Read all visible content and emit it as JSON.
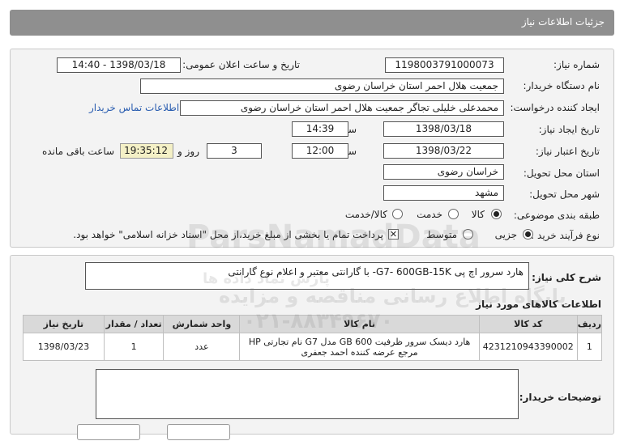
{
  "header": {
    "title": "جزئیات اطلاعات نیاز"
  },
  "form": {
    "need_number_label": "شماره نیاز:",
    "need_number": "1198003791000073",
    "announce_label": "تاریخ و ساعت اعلان عمومی:",
    "announce_value": "1398/03/18 - 14:40",
    "buyer_org_label": "نام دستگاه خریدار:",
    "buyer_org": "جمعیت هلال احمر استان خراسان رضوی",
    "requester_label": "ایجاد کننده درخواست:",
    "requester": "محمدعلی خلیلی تجاگر جمعیت هلال احمر استان خراسان رضوی",
    "contact_link": "اطلاعات تماس خریدار",
    "created_label": "تاریخ ایجاد نیاز:",
    "created_date": "1398/03/18",
    "time_label": "ساعت",
    "created_time": "14:39",
    "validity_label": "تاریخ اعتبار نیاز:",
    "validity_date": "1398/03/22",
    "validity_time": "12:00",
    "days_label": "روز و",
    "days_value": "3",
    "remaining_time": "19:35:12",
    "remaining_label": "ساعت باقی مانده",
    "province_label": "استان محل تحویل:",
    "province": "خراسان رضوی",
    "city_label": "شهر محل تحویل:",
    "city": "مشهد",
    "category_label": "طبقه بندی موضوعی:",
    "category_options": [
      "کالا",
      "خدمت",
      "کالا/خدمت"
    ],
    "category_selected": "کالا",
    "process_label": "نوع فرآیند خرید :",
    "process_options": [
      "جزیی",
      "متوسط"
    ],
    "process_selected": "جزیی",
    "payment_note": "پرداخت تمام یا بخشی از مبلغ خرید،از محل \"اسناد خزانه اسلامی\" خواهد بود."
  },
  "summary": {
    "label": "شرح کلی نیاز:",
    "text": "هارد سرور اچ پی G7- 600GB-15K- با گارانتی معتبر و اعلام نوع گارانتی"
  },
  "items": {
    "title": "اطلاعات کالاهای مورد نیاز",
    "columns": [
      "ردیف",
      "کد کالا",
      "نام کالا",
      "واحد شمارش",
      "تعداد / مقدار",
      "تاریخ نیاز"
    ],
    "rows": [
      {
        "row": "1",
        "code": "4231210943390002",
        "name_line1": "هارد دیسک سرور ظرفیت GB 600 مدل G7 نام تجارتی HP",
        "name_line2": "مرجع عرضه کننده احمد جعفری",
        "unit": "عدد",
        "qty": "1",
        "date": "1398/03/23"
      }
    ]
  },
  "buyer_notes": {
    "label": "توضیحات خریدار:",
    "text": ""
  },
  "watermark": {
    "brand": "ParsNamadData",
    "line1": "پایگاه اطلاع رسانی مناقصه و مزایده",
    "line2": "۰۲۱-۸۸۳۴۹۶۷۰",
    "line3": "پارس نماد داده ها"
  }
}
